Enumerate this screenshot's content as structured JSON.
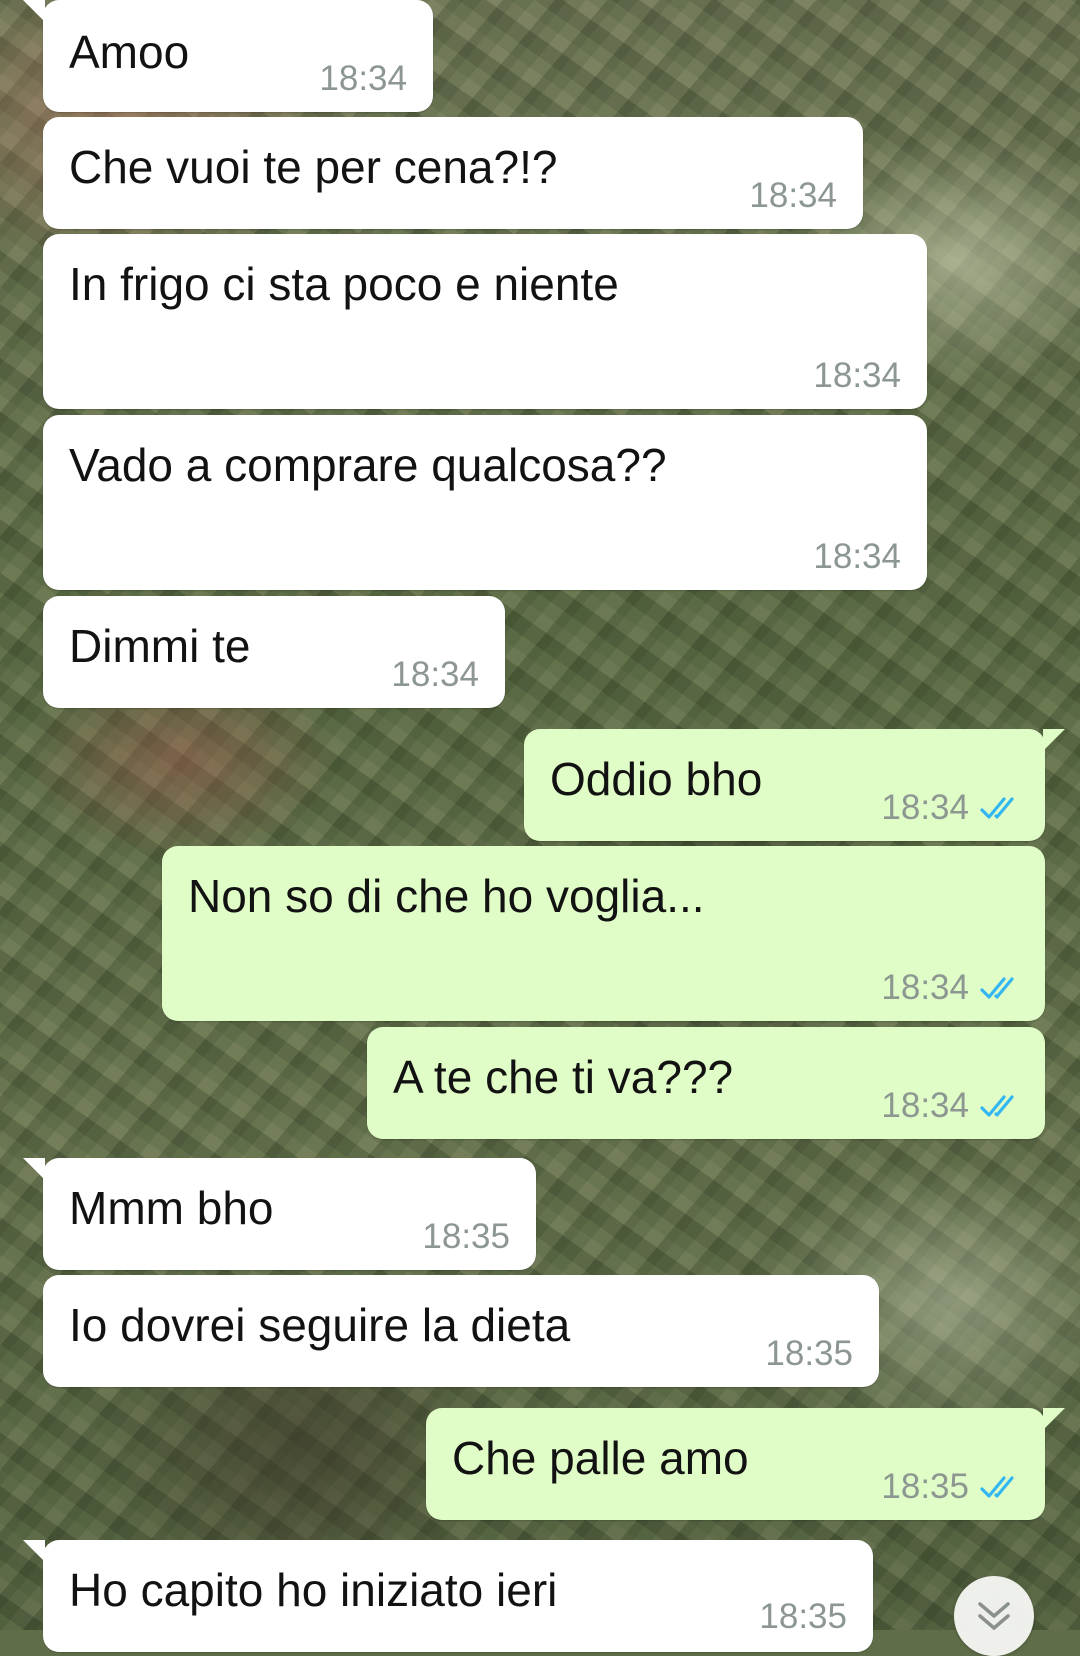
{
  "conversation": {
    "messages": [
      {
        "direction": "incoming",
        "text": "Amoo",
        "time": "18:34"
      },
      {
        "direction": "incoming",
        "text": "Che vuoi te per cena?!?",
        "time": "18:34"
      },
      {
        "direction": "incoming",
        "text": "In frigo ci sta poco e niente",
        "time": "18:34"
      },
      {
        "direction": "incoming",
        "text": "Vado a comprare qualcosa??",
        "time": "18:34"
      },
      {
        "direction": "incoming",
        "text": "Dimmi te",
        "time": "18:34"
      },
      {
        "direction": "outgoing",
        "text": "Oddio bho",
        "time": "18:34",
        "status": "read"
      },
      {
        "direction": "outgoing",
        "text": "Non so di che ho voglia...",
        "time": "18:34",
        "status": "read"
      },
      {
        "direction": "outgoing",
        "text": "A te che ti va???",
        "time": "18:34",
        "status": "read"
      },
      {
        "direction": "incoming",
        "text": "Mmm bho",
        "time": "18:35"
      },
      {
        "direction": "incoming",
        "text": "Io dovrei seguire la dieta",
        "time": "18:35"
      },
      {
        "direction": "outgoing",
        "text": "Che palle amo",
        "time": "18:35",
        "status": "read"
      },
      {
        "direction": "incoming",
        "text": "Ho capito ho iniziato ieri",
        "time": "18:35"
      }
    ]
  },
  "icons": {
    "read_receipt": "double-check-icon",
    "scroll_down": "double-chevron-down-icon"
  },
  "colors": {
    "incoming_bubble": "#ffffff",
    "outgoing_bubble": "#e1fdc7",
    "timestamp": "#8d9791",
    "read_ticks": "#34b7f1",
    "message_text": "#121212"
  }
}
